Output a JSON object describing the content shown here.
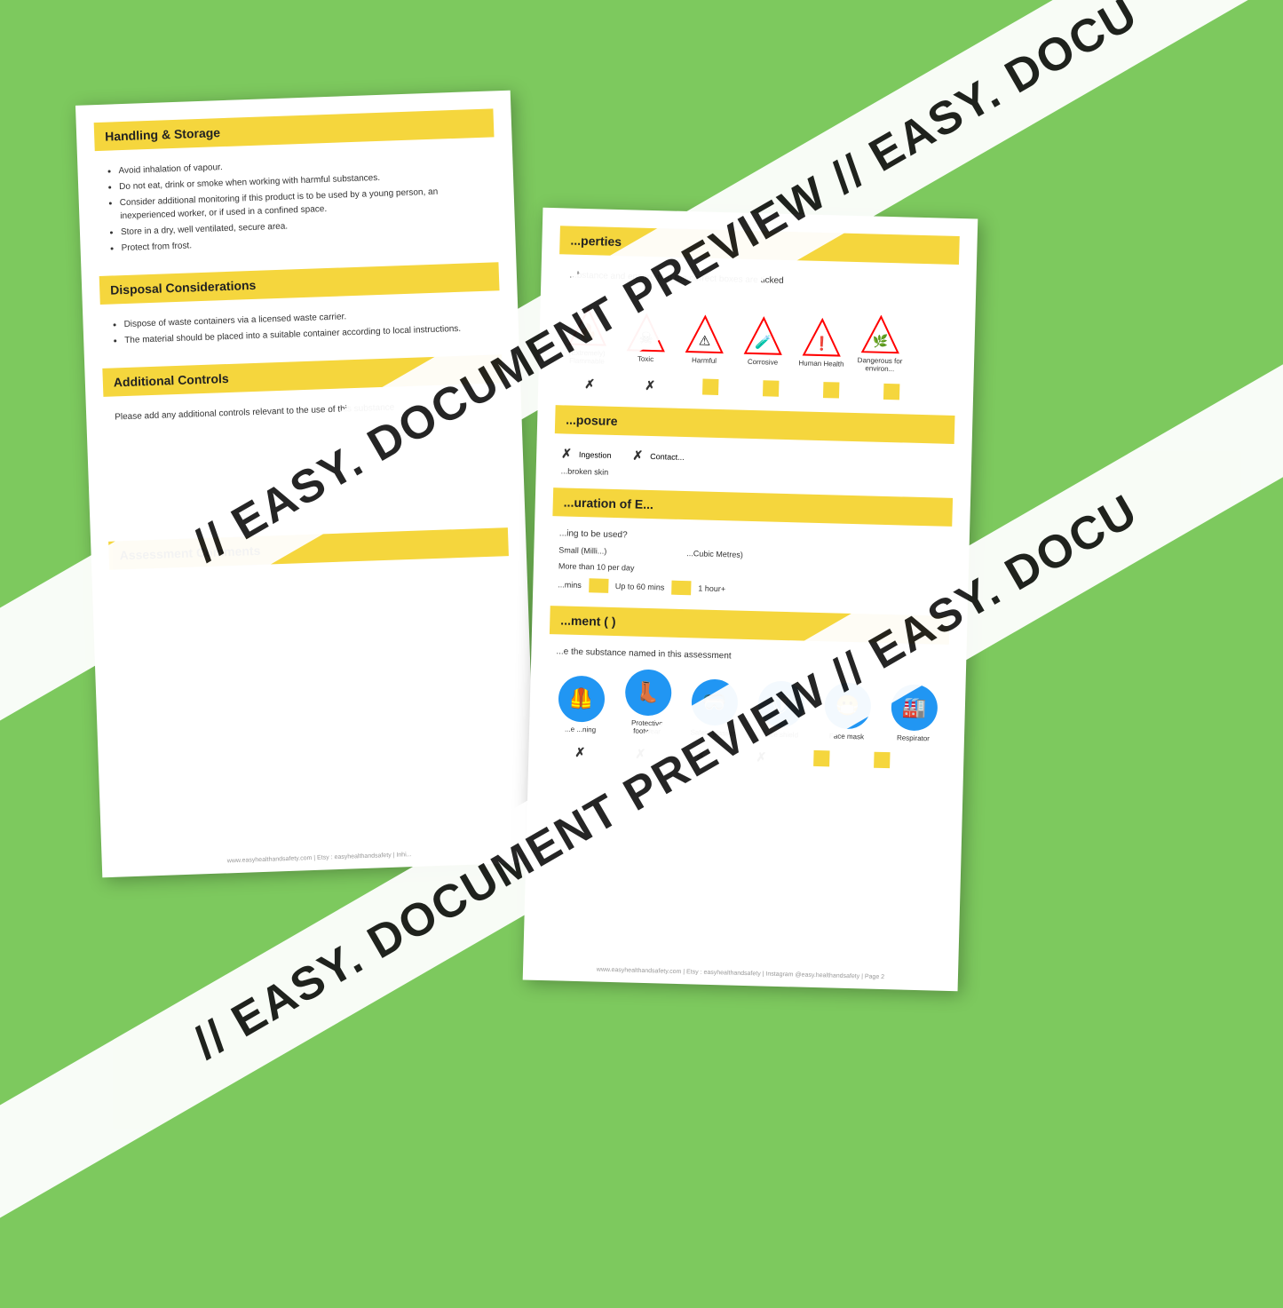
{
  "background_color": "#7dc95e",
  "watermark_text": "// EASY. DOCUMENT PREVIEW //  EASY. DOCU",
  "doc_left": {
    "sections": [
      {
        "id": "handling",
        "header": "Handling & Storage",
        "bullets": [
          "Avoid inhalation of vapour.",
          "Do not eat, drink or smoke when working with harmful substances.",
          "Consider additional monitoring if this product is to be used by a young person, an inexperienced worker, or if used in a confined space.",
          "Store in a dry, well ventilated, secure area.",
          "Protect from frost."
        ]
      },
      {
        "id": "disposal",
        "header": "Disposal Considerations",
        "bullets": [
          "Dispose of waste containers via a licensed waste carrier.",
          "The material should be placed into a suitable container according to local instructions."
        ]
      },
      {
        "id": "additional",
        "header": "Additional Controls",
        "body": "Please add any additional controls relevant to the use of this substance"
      },
      {
        "id": "comments",
        "header": "Assessment Comments",
        "body": ""
      }
    ],
    "footer": "www.easyhealthandsafety.com  |  Etsy : easyhealthandsafety  |  Inhi..."
  },
  "doc_right": {
    "sections": [
      {
        "id": "properties",
        "header": "...perties",
        "body": "...bstance and ensure that the correct boxes are ticked",
        "hazard_icons": [
          {
            "label": "(Extremely) Flammable",
            "symbol": "🔥",
            "checked": "x"
          },
          {
            "label": "Toxic",
            "symbol": "☠",
            "checked": "x"
          },
          {
            "label": "Harmful",
            "symbol": "⚠",
            "checked": "box"
          },
          {
            "label": "Corrosive",
            "symbol": "🧪",
            "checked": "box"
          },
          {
            "label": "Human Health",
            "symbol": "❗",
            "checked": "box"
          },
          {
            "label": "Dangerous for environment",
            "symbol": "🌿",
            "checked": "box"
          }
        ]
      },
      {
        "id": "exposure",
        "header": "...posure",
        "routes": [
          {
            "label": "Ingestion",
            "checked": "x"
          },
          {
            "label": "Contact...",
            "checked": "x"
          },
          {
            "label": "...broken skin",
            "checked": "none"
          }
        ]
      },
      {
        "id": "duration",
        "header": "...uration of E...",
        "body": "...ing to be used?",
        "amount_labels": [
          "Small (Milli...)",
          "...Cubic Metres)"
        ],
        "frequency_label": "More than 10 per day",
        "time_options": [
          {
            "label": "...mins",
            "style": "none"
          },
          {
            "label": "Up to 60 mins",
            "style": "yellow"
          },
          {
            "label": "1 hour+",
            "style": "yellow"
          }
        ]
      },
      {
        "id": "ppe",
        "header": "...ment ( )",
        "body": "...e the substance named in this assessment",
        "ppe_items": [
          {
            "label": "...e ...ning",
            "icon": "🥾"
          },
          {
            "label": "Protective footwear",
            "icon": "👢"
          },
          {
            "label": "Safety glasses",
            "icon": "🥽"
          },
          {
            "label": "Face shield",
            "icon": "🛡"
          },
          {
            "label": "Face mask",
            "icon": "😷"
          },
          {
            "label": "Respirator",
            "icon": "🏭"
          }
        ],
        "ppe_checks": [
          "x",
          "x",
          "x",
          "x",
          "box",
          "box"
        ]
      }
    ],
    "footer": "www.easyhealthandsafety.com  |  Etsy : easyhealthandsafety  |  Instagram @easy.healthandsafety  |  Page 2"
  }
}
